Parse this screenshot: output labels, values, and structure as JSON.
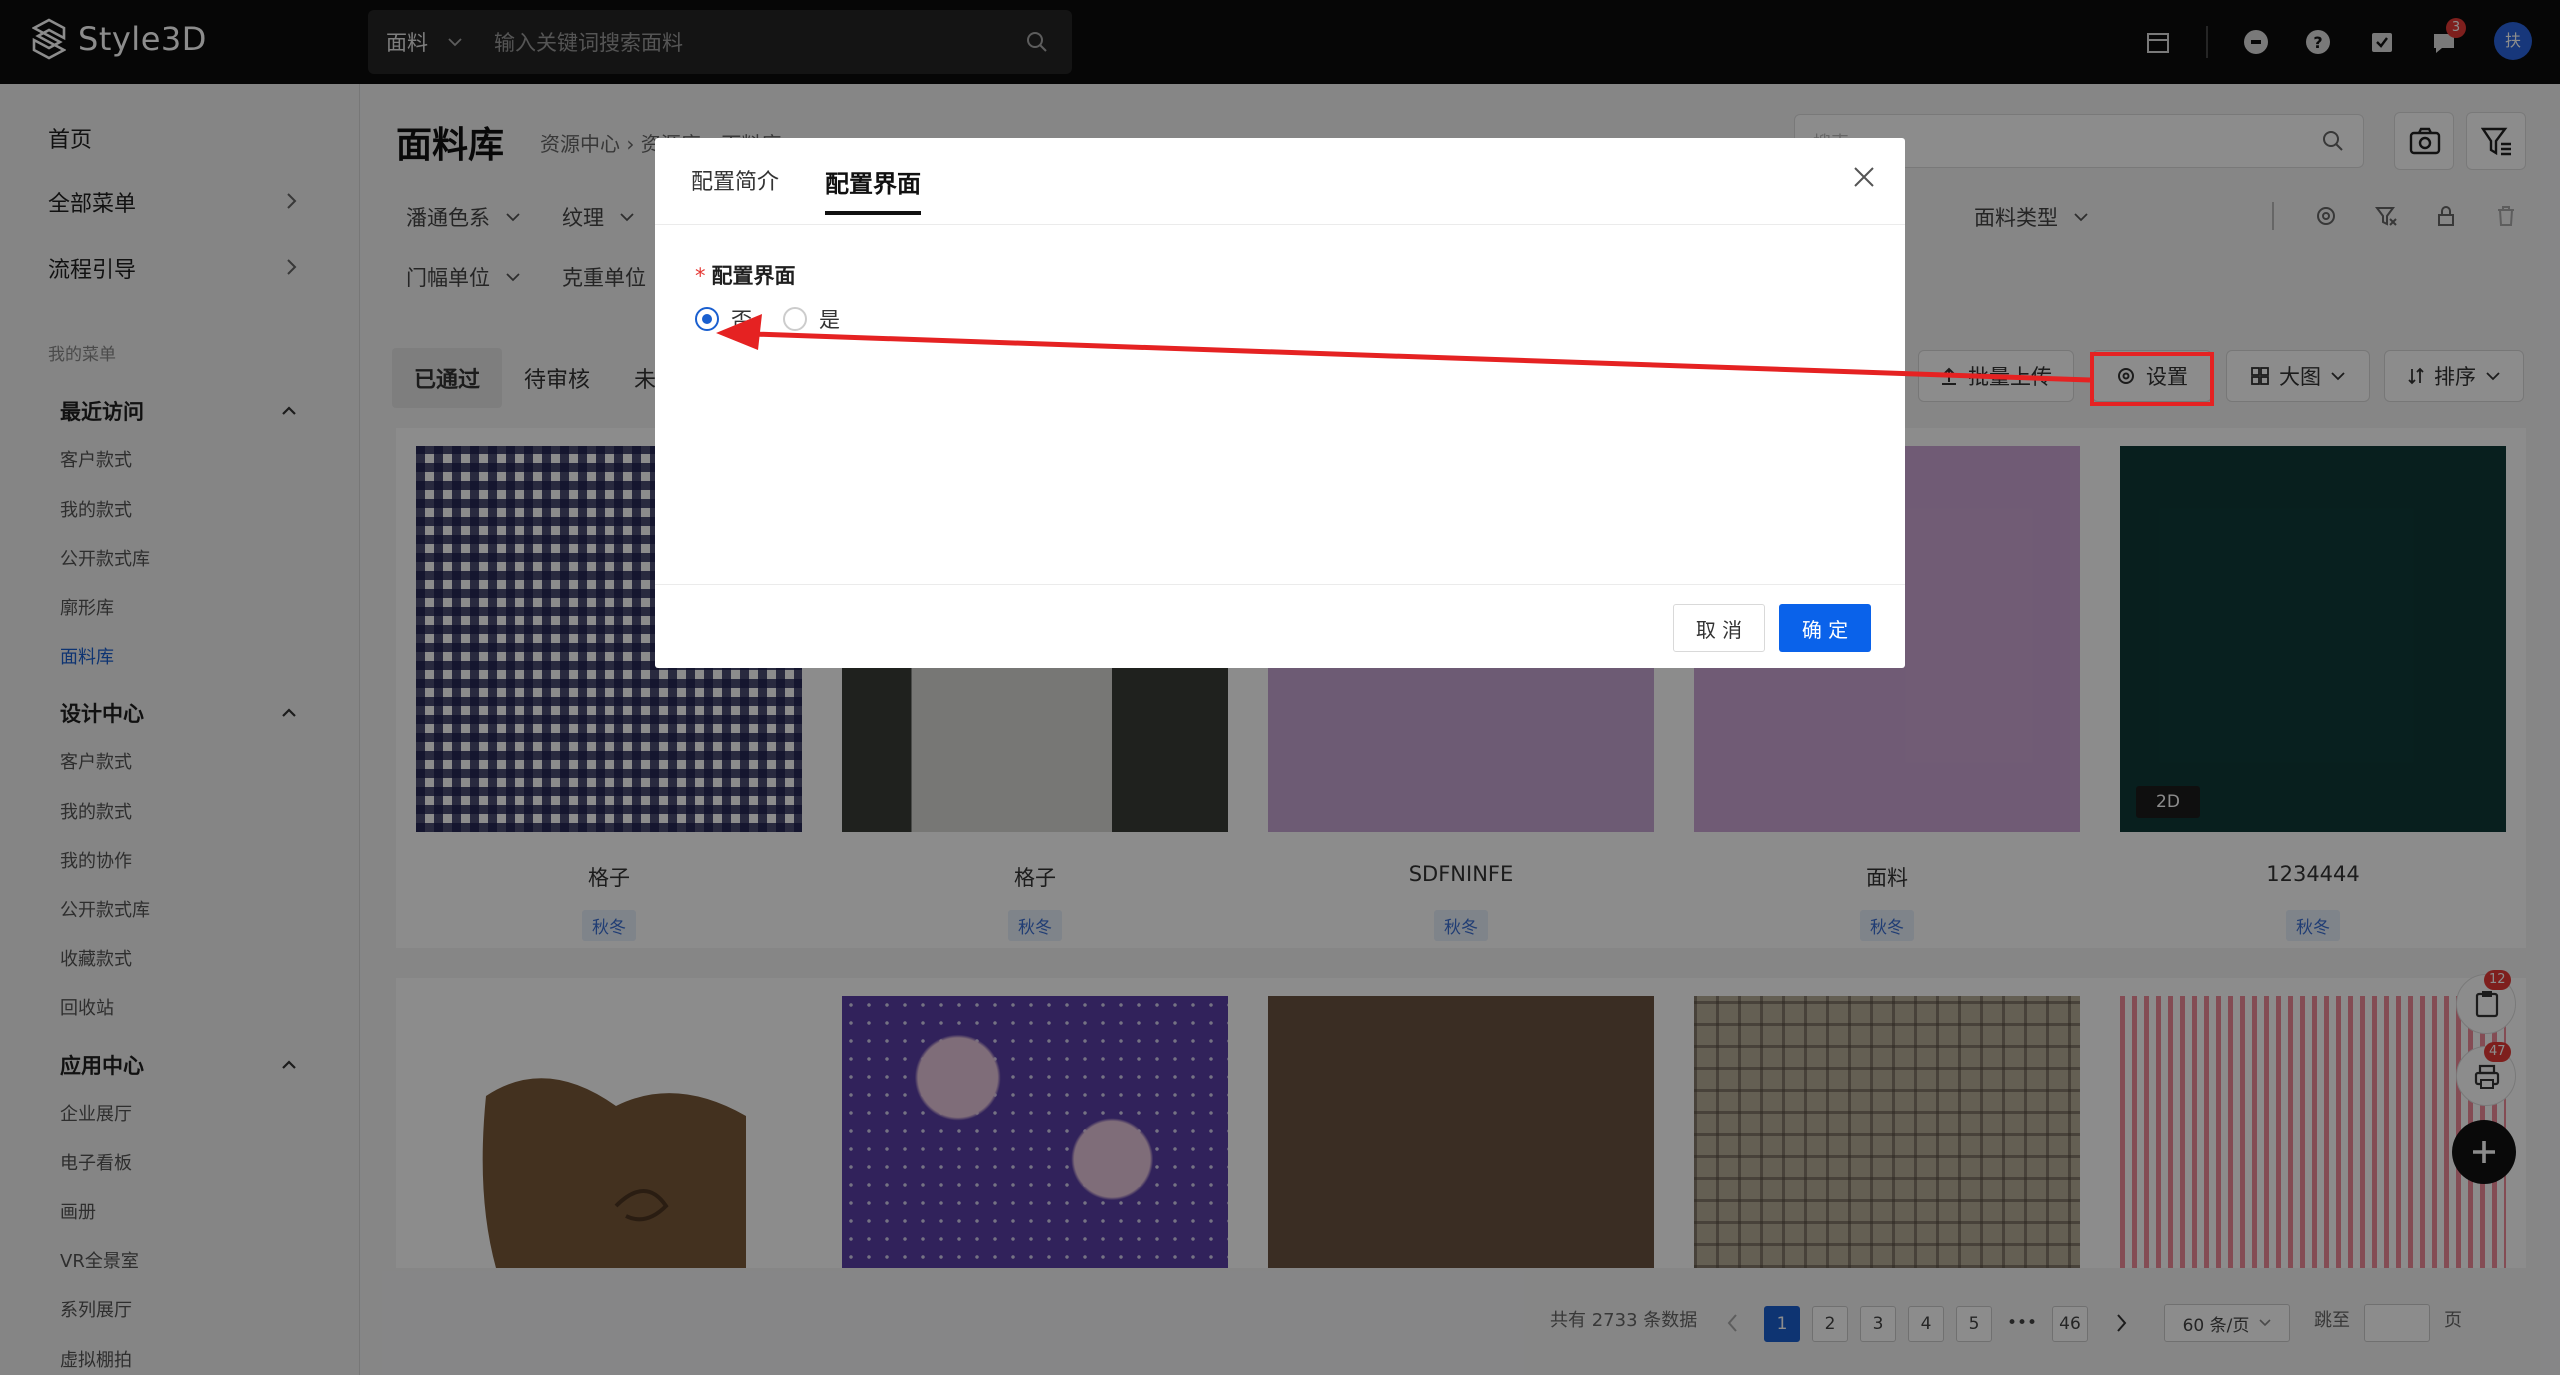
{
  "app": {
    "logo_text": "Style3D",
    "search_category": "面料",
    "search_placeholder": "输入关键词搜索面料",
    "notification_count": "3",
    "avatar_text": "扶"
  },
  "sidebar": {
    "top_items": [
      {
        "label": "首页"
      },
      {
        "label": "全部菜单"
      },
      {
        "label": "流程引导"
      }
    ],
    "my_menu_label": "我的菜单",
    "groups": [
      {
        "title": "最近访问",
        "items": [
          "客户款式",
          "我的款式",
          "公开款式库",
          "廓形库",
          "面料库"
        ]
      },
      {
        "title": "设计中心",
        "items": [
          "客户款式",
          "我的款式",
          "我的协作",
          "公开款式库",
          "收藏款式",
          "回收站"
        ]
      },
      {
        "title": "应用中心",
        "items": [
          "企业展厅",
          "电子看板",
          "画册",
          "VR全景室",
          "系列展厅",
          "虚拟棚拍"
        ]
      }
    ]
  },
  "page": {
    "title": "面料库",
    "breadcrumb": "资源中心 › 资源库 › 面料库",
    "search_placeholder": "搜索",
    "filters_row1": [
      "潘通色系",
      "纹理",
      "面料类型"
    ],
    "filters_row2": [
      "门幅单位",
      "克重单位"
    ],
    "status_tabs": [
      "已通过",
      "待审核",
      "未"
    ],
    "toolbar": {
      "upload": "批量上传",
      "settings": "设置",
      "view": "大图",
      "sort": "排序"
    }
  },
  "grid": {
    "row1": [
      {
        "name": "格子",
        "tag": "秋冬"
      },
      {
        "name": "格子",
        "tag": "秋冬"
      },
      {
        "name": "SDFNINFE",
        "tag": "秋冬"
      },
      {
        "name": "面料",
        "tag": "秋冬"
      },
      {
        "name": "1234444",
        "tag": "秋冬",
        "badge": "2D"
      }
    ],
    "row1_colors": [
      "#2b2d58",
      "#4a4e49",
      "#9c7aa8",
      "#a97fb0",
      "#0f3a38"
    ]
  },
  "pagination": {
    "total": "共有 2733 条数据",
    "pages": [
      "1",
      "2",
      "3",
      "4",
      "5",
      "•••",
      "46"
    ],
    "page_size": "60 条/页",
    "jump_label": "跳至",
    "page_unit": "页"
  },
  "floating": {
    "cart_count": "12",
    "print_count": "47"
  },
  "modal": {
    "tabs": [
      "配置简介",
      "配置界面"
    ],
    "active_tab": "配置界面",
    "field_label": "配置界面",
    "required_mark": "*",
    "options": [
      "否",
      "是"
    ],
    "selected_option": "否",
    "cancel_label": "取 消",
    "ok_label": "确 定"
  },
  "colors": {
    "accent": "#0a62ea",
    "annotation": "#e52222"
  }
}
